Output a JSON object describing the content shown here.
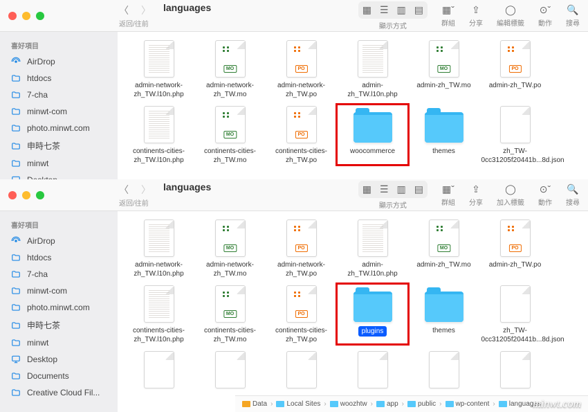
{
  "windows": [
    {
      "title": "languages",
      "nav_subtitle": "返回/往前",
      "toolbar": {
        "view_label": "顯示方式",
        "group_label": "群組",
        "share_label": "分享",
        "tags_label": "編輯標籤",
        "actions_label": "動作",
        "search_label": "搜尋"
      },
      "sidebar_header": "喜好項目",
      "sidebar": [
        {
          "icon": "airdrop",
          "label": "AirDrop"
        },
        {
          "icon": "folder",
          "label": "htdocs"
        },
        {
          "icon": "folder",
          "label": "7-cha"
        },
        {
          "icon": "folder",
          "label": "minwt-com"
        },
        {
          "icon": "folder",
          "label": "photo.minwt.com"
        },
        {
          "icon": "folder",
          "label": "申時七茶"
        },
        {
          "icon": "folder",
          "label": "minwt"
        },
        {
          "icon": "desktop",
          "label": "Desktop"
        }
      ],
      "files": [
        {
          "kind": "php",
          "name": "admin-network-zh_TW.l10n.php"
        },
        {
          "kind": "mo",
          "name": "admin-network-zh_TW.mo"
        },
        {
          "kind": "po",
          "name": "admin-network-zh_TW.po"
        },
        {
          "kind": "php",
          "name": "admin-zh_TW.l10n.php"
        },
        {
          "kind": "mo",
          "name": "admin-zh_TW.mo"
        },
        {
          "kind": "po",
          "name": "admin-zh_TW.po"
        },
        {
          "kind": "php",
          "name": "continents-cities-zh_TW.l10n.php"
        },
        {
          "kind": "mo",
          "name": "continents-cities-zh_TW.mo"
        },
        {
          "kind": "po",
          "name": "continents-cities-zh_TW.po"
        },
        {
          "kind": "folder",
          "name": "woocommerce",
          "highlighted": true
        },
        {
          "kind": "folder",
          "name": "themes"
        },
        {
          "kind": "json",
          "name": "zh_TW-0cc31205f20441b...8d.json"
        }
      ]
    },
    {
      "title": "languages",
      "nav_subtitle": "返回/往前",
      "toolbar": {
        "view_label": "顯示方式",
        "group_label": "群組",
        "share_label": "分享",
        "tags_label": "加入標籤",
        "actions_label": "動作",
        "search_label": "搜尋"
      },
      "sidebar_header": "喜好項目",
      "sidebar": [
        {
          "icon": "airdrop",
          "label": "AirDrop"
        },
        {
          "icon": "folder",
          "label": "htdocs"
        },
        {
          "icon": "folder",
          "label": "7-cha"
        },
        {
          "icon": "folder",
          "label": "minwt-com"
        },
        {
          "icon": "folder",
          "label": "photo.minwt.com"
        },
        {
          "icon": "folder",
          "label": "申時七茶"
        },
        {
          "icon": "folder",
          "label": "minwt"
        },
        {
          "icon": "desktop",
          "label": "Desktop"
        },
        {
          "icon": "folder",
          "label": "Documents"
        },
        {
          "icon": "folder",
          "label": "Creative Cloud Fil..."
        }
      ],
      "files": [
        {
          "kind": "php",
          "name": "admin-network-zh_TW.l10n.php"
        },
        {
          "kind": "mo",
          "name": "admin-network-zh_TW.mo"
        },
        {
          "kind": "po",
          "name": "admin-network-zh_TW.po"
        },
        {
          "kind": "php",
          "name": "admin-zh_TW.l10n.php"
        },
        {
          "kind": "mo",
          "name": "admin-zh_TW.mo"
        },
        {
          "kind": "po",
          "name": "admin-zh_TW.po"
        },
        {
          "kind": "php",
          "name": "continents-cities-zh_TW.l10n.php"
        },
        {
          "kind": "mo",
          "name": "continents-cities-zh_TW.mo"
        },
        {
          "kind": "po",
          "name": "continents-cities-zh_TW.po"
        },
        {
          "kind": "folder",
          "name": "plugins",
          "highlighted": true,
          "selected": true
        },
        {
          "kind": "folder",
          "name": "themes"
        },
        {
          "kind": "json",
          "name": "zh_TW-0cc31205f20441b...8d.json"
        },
        {
          "kind": "json",
          "name": ""
        },
        {
          "kind": "json",
          "name": ""
        },
        {
          "kind": "json",
          "name": ""
        },
        {
          "kind": "json",
          "name": ""
        },
        {
          "kind": "json",
          "name": ""
        },
        {
          "kind": "json",
          "name": ""
        }
      ],
      "pathbar": [
        "Data",
        "Local Sites",
        "woozhtw",
        "app",
        "public",
        "wp-content",
        "languages"
      ]
    }
  ],
  "watermark": "minwt.com"
}
